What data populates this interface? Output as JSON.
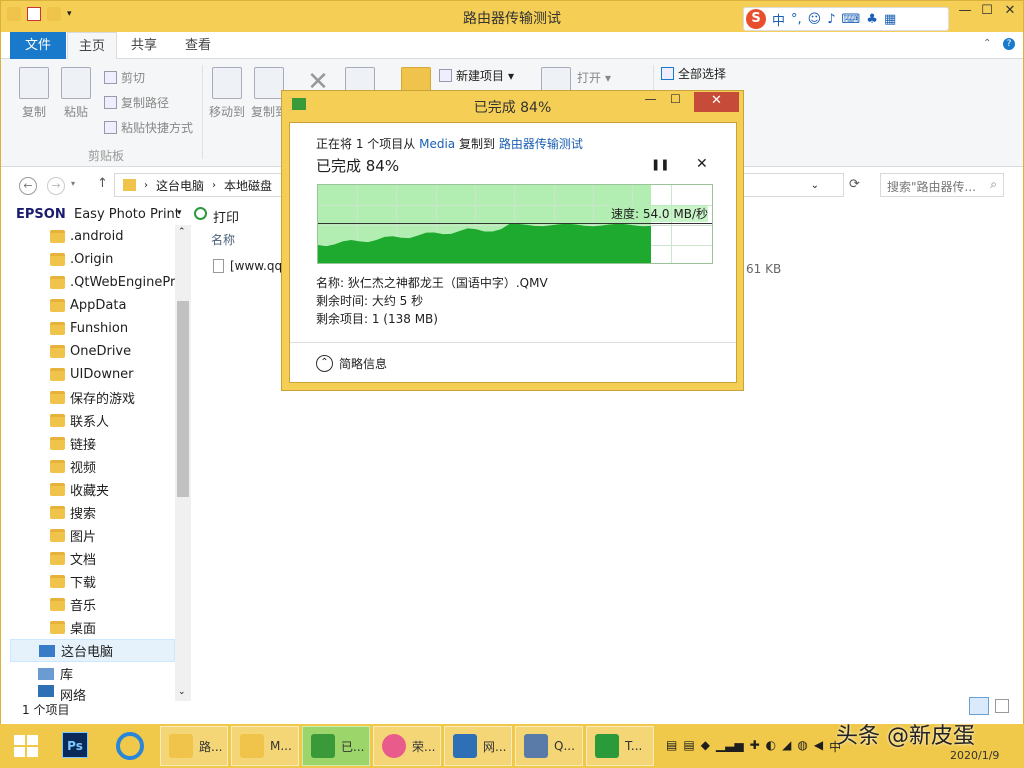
{
  "window": {
    "title": "路由器传输测试"
  },
  "ime": {
    "label1": "中",
    "label2": "°,"
  },
  "controls": {
    "minimize": "—",
    "maximize": "☐",
    "close": "✕"
  },
  "tabs": [
    "文件",
    "主页",
    "共享",
    "查看"
  ],
  "ribbon": {
    "copy": "复制",
    "paste": "粘贴",
    "cut": "剪切",
    "copy_path": "复制路径",
    "paste_shortcut": "粘贴快捷方式",
    "clipboard_group": "剪贴板",
    "move_to": "移动到",
    "copy_to": "复制到",
    "new_item": "新建项目",
    "open": "打开",
    "select_all": "全部选择"
  },
  "address": {
    "crumbs": [
      "这台电脑",
      "本地磁盘"
    ],
    "search_placeholder": "搜索\"路由器传..."
  },
  "cmdbar": {
    "brand": "EPSON",
    "app": "Easy Photo Print",
    "print": "打印"
  },
  "sidebar": {
    "items": [
      ".android",
      ".Origin",
      ".QtWebEngineProc",
      "AppData",
      "Funshion",
      "OneDrive",
      "UIDowner",
      "保存的游戏",
      "联系人",
      "链接",
      "视频",
      "收藏夹",
      "搜索",
      "图片",
      "文档",
      "下载",
      "音乐",
      "桌面"
    ],
    "this_pc": "这台电脑",
    "library": "库",
    "network": "网络"
  },
  "main": {
    "col_name": "名称",
    "file_name": "[www.qq",
    "file_size": "61 KB"
  },
  "status": {
    "count": "1 个项目"
  },
  "dialog": {
    "title": "已完成 84%",
    "line_prefix": "正在将 1 个项目从",
    "source": "Media",
    "copy_to": "复制到",
    "dest": "路由器传输测试",
    "progress_label": "已完成 84%",
    "speed": "速度: 54.0 MB/秒",
    "name_row": "名称: 狄仁杰之神都龙王（国语中字）.QMV",
    "time_left": "剩余时间: 大约 5 秒",
    "items_left": "剩余项目: 1 (138 MB)",
    "details_toggle": "简略信息",
    "progress": 0.84
  },
  "taskbar": {
    "items": [
      "路...",
      "M...",
      "已...",
      "荣...",
      "网...",
      "Q...",
      "T..."
    ],
    "date": "2020/1/9",
    "watermark": "头条 @新皮蛋",
    "lang": "中"
  }
}
